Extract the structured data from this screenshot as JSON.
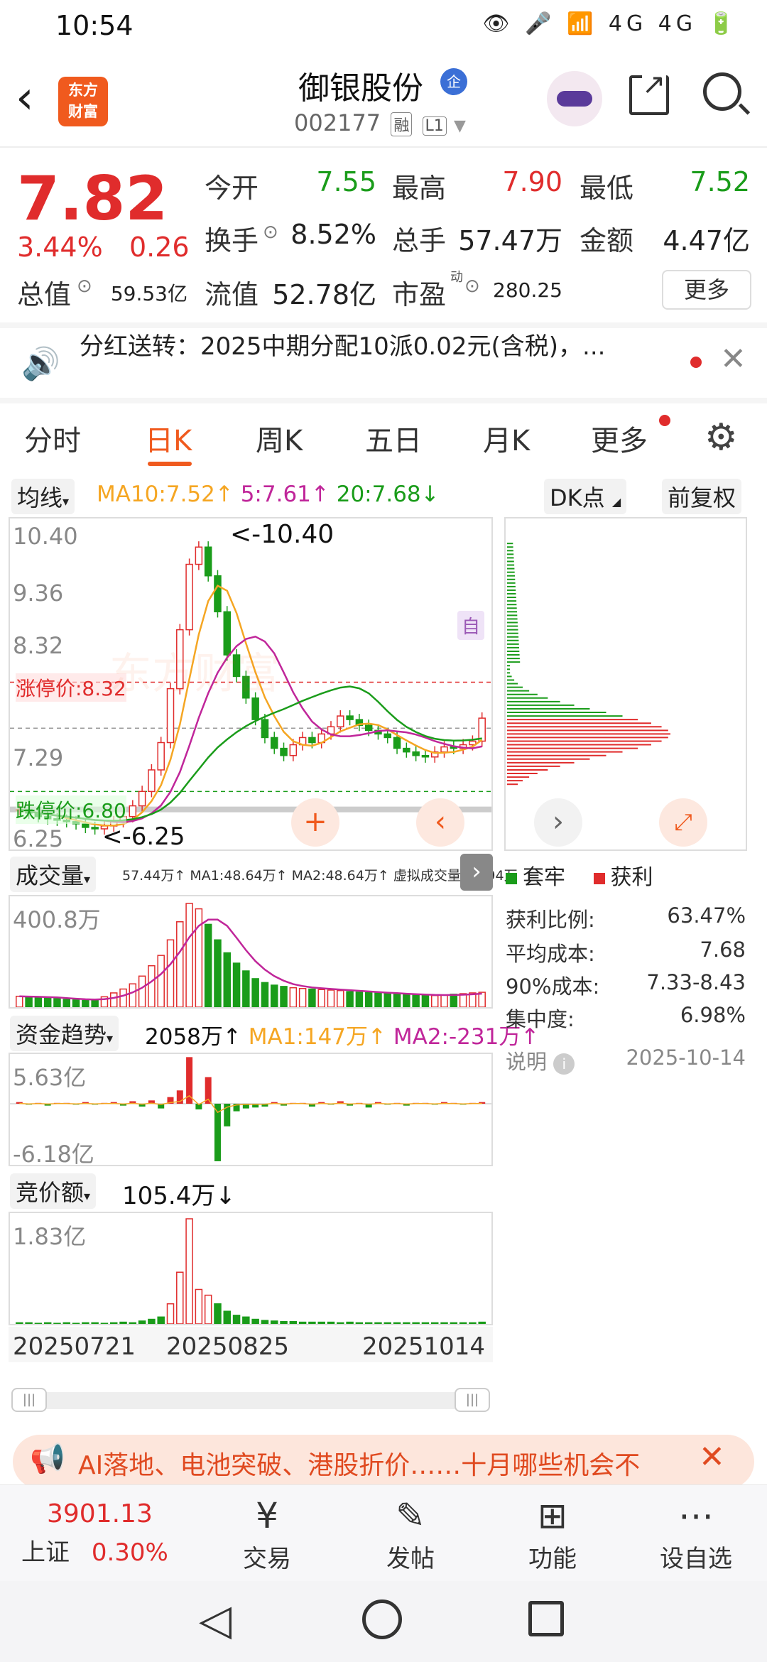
{
  "status_bar": {
    "time": "10:54",
    "icons": "👁 🎤 📶 4G 4G 🔋"
  },
  "header": {
    "stock_name": "御银股份",
    "badge": "企",
    "stock_code": "002177",
    "tag_margin": "融",
    "tag_level": "L1",
    "logo_line1": "东方",
    "logo_line2": "财富"
  },
  "quote": {
    "price": "7.82",
    "change_pct": "3.44%",
    "change_amt": "0.26",
    "fields": [
      {
        "label": "今开",
        "value": "7.55",
        "color": "#1a9c1a"
      },
      {
        "label": "最高",
        "value": "7.90",
        "color": "#e02c2c"
      },
      {
        "label": "最低",
        "value": "7.52",
        "color": "#1a9c1a"
      },
      {
        "label": "换手",
        "value": "8.52%",
        "color": "#222222"
      },
      {
        "label": "总手",
        "value": "57.47万",
        "color": "#222222"
      },
      {
        "label": "金额",
        "value": "4.47亿",
        "color": "#222222"
      },
      {
        "label": "总值",
        "value": "59.53亿",
        "color": "#222222"
      },
      {
        "label": "流值",
        "value": "52.78亿",
        "color": "#222222"
      },
      {
        "label": "市盈",
        "value": "280.25",
        "color": "#222222"
      }
    ],
    "pe_superscript": "动",
    "more_label": "更多"
  },
  "notice": {
    "text": "分红送转：2025中期分配10派0.02元(含税)，..."
  },
  "tabs": [
    "分时",
    "日K",
    "周K",
    "五日",
    "月K",
    "更多"
  ],
  "active_tab": "日K",
  "ma_row": {
    "dropdown": "均线",
    "ma10": "MA10:7.52↑",
    "ma5": "5:7.61↑",
    "ma20": "20:7.68↓",
    "dk_label": "DK点",
    "adjust_label": "前复权"
  },
  "kline": {
    "y_labels": [
      "10.40",
      "9.36",
      "8.32",
      "7.29",
      "6.25"
    ],
    "limit_up": "涨停价:8.32",
    "limit_down": "跌停价:6.80",
    "max_label": "<-10.40",
    "min_label": "<-6.25",
    "marker": "自",
    "watermark": "东方财富"
  },
  "chart_data": [
    {
      "type": "candlestick",
      "title": "日K",
      "ylim": [
        6.25,
        10.4
      ],
      "ma": {
        "MA5": 7.61,
        "MA10": 7.52,
        "MA20": 7.68
      },
      "closes": [
        6.55,
        6.5,
        6.45,
        6.42,
        6.4,
        6.38,
        6.35,
        6.3,
        6.28,
        6.32,
        6.38,
        6.45,
        6.6,
        6.8,
        7.1,
        7.48,
        8.23,
        9.05,
        9.96,
        10.2,
        9.8,
        9.3,
        8.7,
        8.4,
        8.1,
        7.8,
        7.55,
        7.4,
        7.3,
        7.45,
        7.55,
        7.48,
        7.6,
        7.7,
        7.85,
        7.8,
        7.72,
        7.65,
        7.6,
        7.55,
        7.4,
        7.35,
        7.3,
        7.28,
        7.35,
        7.42,
        7.4,
        7.45,
        7.5,
        7.82
      ]
    },
    {
      "type": "bar",
      "title": "成交量",
      "ylim": [
        0,
        400.8
      ],
      "values_wan": [
        42,
        40,
        38,
        35,
        33,
        30,
        28,
        26,
        30,
        40,
        55,
        70,
        90,
        120,
        160,
        200,
        260,
        330,
        400.8,
        380,
        320,
        260,
        210,
        170,
        140,
        110,
        95,
        85,
        80,
        75,
        72,
        70,
        68,
        66,
        64,
        60,
        58,
        56,
        54,
        52,
        50,
        48,
        47,
        46,
        45,
        47,
        50,
        52,
        55,
        57.44
      ]
    },
    {
      "type": "bar",
      "title": "资金趋势",
      "ylim": [
        -6.18,
        5.63
      ],
      "units": "亿"
    },
    {
      "type": "bar",
      "title": "竞价额",
      "ylim": [
        0,
        1.83
      ],
      "units": "亿"
    }
  ],
  "volume": {
    "dropdown": "成交量",
    "stats": "57.44万↑ MA1:48.64万↑ MA2:48.64万↑ 虚拟成交量:71.94万",
    "y_top": "400.8万"
  },
  "fund": {
    "dropdown": "资金趋势",
    "value": "2058万↑",
    "ma1": "MA1:147万↑",
    "ma2": "MA2:-231万↑",
    "y_top": "5.63亿",
    "y_bottom": "-6.18亿"
  },
  "auction": {
    "dropdown": "竞价额",
    "value": "105.4万↓",
    "y_top": "1.83亿",
    "dates": [
      "20250721",
      "20250825",
      "20251014"
    ]
  },
  "chips": {
    "legend_trapped": "套牢",
    "legend_profit": "获利",
    "stats": [
      {
        "label": "获利比例:",
        "value": "63.47%"
      },
      {
        "label": "平均成本:",
        "value": "7.68"
      },
      {
        "label": "90%成本:",
        "value": "7.33-8.43"
      },
      {
        "label": "集中度:",
        "value": "6.98%"
      }
    ],
    "note_label": "说明",
    "date": "2025-10-14"
  },
  "ad": {
    "text": "AI落地、电池突破、港股折价……十月哪些机会不"
  },
  "bottom_bar": {
    "index_value": "3901.13",
    "index_name": "上证",
    "index_pct": "0.30%",
    "items": [
      {
        "label": "交易",
        "icon": "¥"
      },
      {
        "label": "发帖",
        "icon": "✎"
      },
      {
        "label": "功能",
        "icon": "⊞"
      },
      {
        "label": "设自选",
        "icon": "⋯"
      }
    ]
  },
  "colors": {
    "up": "#e02c2c",
    "down": "#1a9c1a",
    "accent": "#f05a1e",
    "ma5": "#f5a623",
    "ma10": "#c0269a",
    "ma20": "#1a9c1a"
  }
}
